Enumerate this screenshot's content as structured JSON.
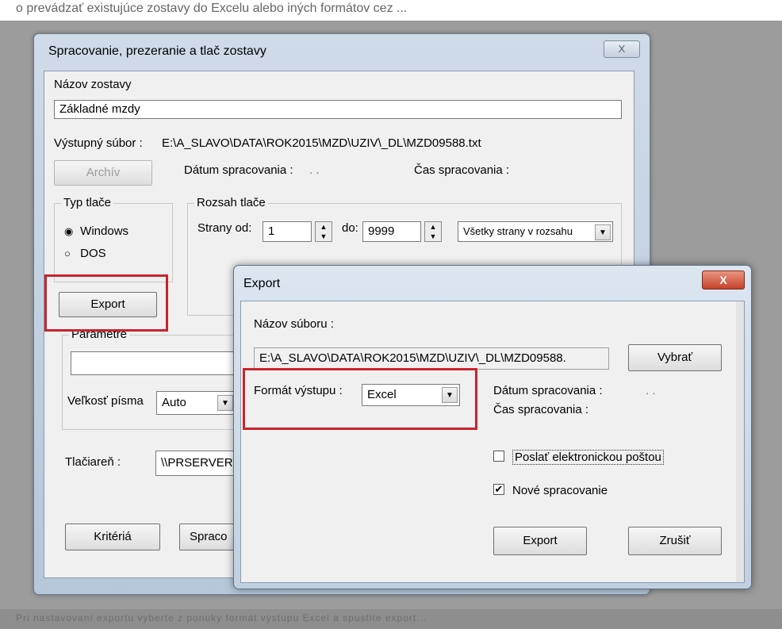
{
  "background": {
    "top_text": "o prevádzať existujúce zostavy do Excelu alebo iných formátov cez ...",
    "bottom_text": "Pri nastavovaní exportu vyberte z ponuky formát výstupu Excel a spustite export..."
  },
  "main_window": {
    "title": "Spracovanie, prezeranie a tlač zostavy",
    "close_glyph": "X",
    "report_name_label": "Názov zostavy",
    "report_name_value": "Základné mzdy",
    "output_file_label": "Výstupný súbor :",
    "output_file_value": "E:\\A_SLAVO\\DATA\\ROK2015\\MZD\\UZIV\\_DL\\MZD09588.txt",
    "archive_button": "Archív",
    "processing_date_label": "Dátum spracovania :",
    "processing_date_value": ". .",
    "processing_time_label": "Čas spracovania :",
    "print_type_group": "Typ tlače",
    "print_type_options": [
      "Windows",
      "DOS"
    ],
    "print_range_group": "Rozsah tlače",
    "pages_from_label": "Strany od:",
    "pages_from_value": "1",
    "pages_to_label": "do:",
    "pages_to_value": "9999",
    "pages_mode_value": "Všetky strany v rozsahu",
    "export_button": "Export",
    "parameters_label": "Parametre",
    "font_size_label": "Veľkosť písma",
    "font_size_value": "Auto",
    "printer_label": "Tlačiareň :",
    "printer_value": "\\\\PRSERVER",
    "criteria_button": "Kritériá",
    "process_button": "Spraco"
  },
  "export_dialog": {
    "title": "Export",
    "close_glyph": "X",
    "file_name_label": "Názov súboru :",
    "file_name_value": "E:\\A_SLAVO\\DATA\\ROK2015\\MZD\\UZIV\\_DL\\MZD09588.",
    "choose_button": "Vybrať",
    "output_format_label": "Formát výstupu :",
    "output_format_value": "Excel",
    "processing_date_label": "Dátum spracovania :",
    "processing_date_value": ". .",
    "processing_time_label": "Čas spracovania :",
    "send_email_label": "Poslať elektronickou poštou",
    "send_email_checked": false,
    "new_processing_label": "Nové spracovanie",
    "new_processing_checked": true,
    "export_button": "Export",
    "cancel_button": "Zrušiť"
  },
  "colors": {
    "highlight": "#c8242d",
    "window_frame": "#b6c7da",
    "client_bg": "#f0f0f0"
  }
}
